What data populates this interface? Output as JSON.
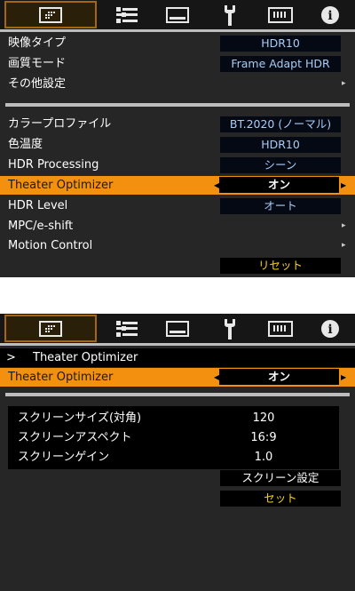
{
  "colors": {
    "selection": "#f4900f",
    "value_text": "#a9cdf6",
    "button_text": "#f7d21b",
    "panel_bg": "#262626"
  },
  "tabs": [
    {
      "icon": "picture-icon"
    },
    {
      "icon": "settings-sliders-icon"
    },
    {
      "icon": "display-icon"
    },
    {
      "icon": "wrench-icon"
    },
    {
      "icon": "connector-icon"
    },
    {
      "icon": "info-icon",
      "label": "i"
    }
  ],
  "top_menu": {
    "rows1": [
      {
        "label": "映像タイプ",
        "value": "HDR10"
      },
      {
        "label": "画質モード",
        "value": "Frame Adapt HDR"
      },
      {
        "label": "その他設定",
        "arrow": "▸"
      }
    ],
    "rows2": [
      {
        "label": "カラープロファイル",
        "value": "BT.2020 (ノーマル)"
      },
      {
        "label": "色温度",
        "value": "HDR10"
      },
      {
        "label": "HDR Processing",
        "value": "シーン"
      },
      {
        "label": "Theater Optimizer",
        "value": "オン",
        "left": "◀",
        "right": "▶"
      },
      {
        "label": "HDR Level",
        "value": "オート"
      },
      {
        "label": "MPC/e-shift",
        "arrow": "▸"
      },
      {
        "label": "Motion Control",
        "arrow": "▸"
      }
    ],
    "reset_label": "リセット"
  },
  "bottom_menu": {
    "header_marker": ">",
    "header_title": "Theater Optimizer",
    "selected": {
      "label": "Theater Optimizer",
      "value": "オン",
      "left": "◀",
      "right": "▶"
    },
    "settings": [
      {
        "label": "スクリーンサイズ(対角)",
        "value": "120"
      },
      {
        "label": "スクリーンアスペクト",
        "value": "16:9"
      },
      {
        "label": "スクリーンゲイン",
        "value": "1.0"
      }
    ],
    "screen_setting_label": "スクリーン設定",
    "set_label": "セット"
  }
}
